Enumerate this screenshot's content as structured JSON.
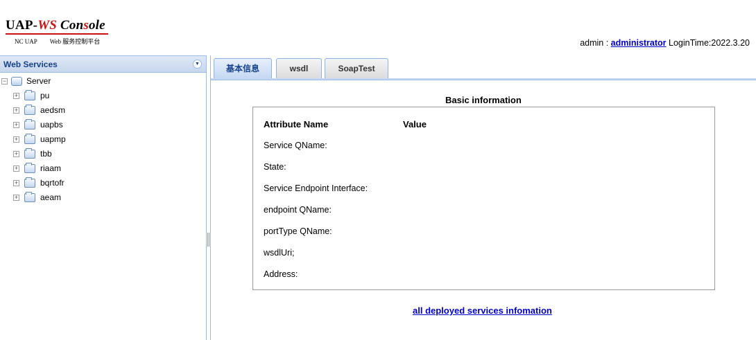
{
  "header": {
    "logo_part1": "UAP-",
    "logo_part2": "WS",
    "logo_part3": " Con",
    "logo_part4": "s",
    "logo_part5": "ole",
    "sub_left": "NC UAP",
    "sub_right": "Web 服务控制平台",
    "user_label": "admin : ",
    "user_link": "administrator",
    "login_time": " LoginTime:2022.3.20",
    "accent_color": "#cc1111"
  },
  "sidebar": {
    "title": "Web Services",
    "root": "Server",
    "items": [
      {
        "label": "pu"
      },
      {
        "label": "aedsm"
      },
      {
        "label": "uapbs"
      },
      {
        "label": "uapmp"
      },
      {
        "label": "tbb"
      },
      {
        "label": "riaam"
      },
      {
        "label": "bqrtofr"
      },
      {
        "label": "aeam"
      }
    ]
  },
  "tabs": [
    {
      "label": "基本信息",
      "active": true
    },
    {
      "label": "wsdl",
      "active": false
    },
    {
      "label": "SoapTest",
      "active": false
    }
  ],
  "basic": {
    "title": "Basic information",
    "col_name": "Attribute Name",
    "col_value": "Value",
    "rows": [
      {
        "name": "Service QName:"
      },
      {
        "name": "State:"
      },
      {
        "name": "Service Endpoint Interface:"
      },
      {
        "name": "endpoint QName:"
      },
      {
        "name": "portType QName:"
      },
      {
        "name": "wsdlUri;"
      },
      {
        "name": "Address:"
      }
    ],
    "all_link": "all deployed services infomation"
  }
}
